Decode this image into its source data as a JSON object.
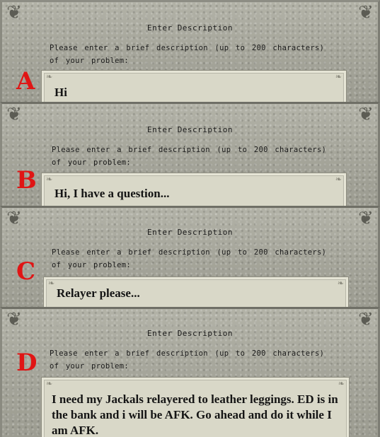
{
  "dialog": {
    "title": "Enter Description",
    "prompt": "Please enter a brief description (up to 200 characters) of your problem:",
    "corner_glyph": "❦",
    "deco_glyph": "❧"
  },
  "panels": [
    {
      "letter": "A",
      "text": "Hi"
    },
    {
      "letter": "B",
      "text": "Hi, I have a question..."
    },
    {
      "letter": "C",
      "text": "Relayer please..."
    },
    {
      "letter": "D",
      "text": "I need my Jackals relayered to leather leggings. ED is in the bank and i will be AFK.  Go ahead and do it while I am AFK."
    }
  ],
  "colors": {
    "label_red": "#e01515",
    "stone": "#a7a79c",
    "parchment": "#d9d8c8"
  }
}
